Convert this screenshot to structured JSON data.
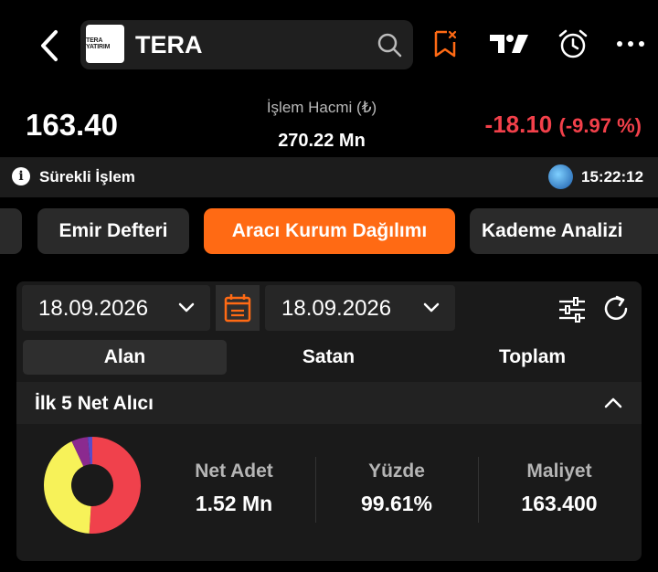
{
  "header": {
    "logo_text": "TERA YATIRIM",
    "ticker": "TERA"
  },
  "quote": {
    "price": "163.40",
    "volume_label": "İşlem Hacmi (₺)",
    "volume_value": "270.22 Mn",
    "change": "-18.10",
    "change_pct": "(-9.97 %)"
  },
  "status": {
    "session": "Sürekli İşlem",
    "time": "15:22:12"
  },
  "tabs": [
    {
      "label": "Emir Defteri",
      "active": false
    },
    {
      "label": "Aracı Kurum Dağılımı",
      "active": true
    },
    {
      "label": "Kademe Analizi",
      "active": false
    }
  ],
  "filters": {
    "start_date": "18.09.2026",
    "end_date": "18.09.2026"
  },
  "segments": [
    {
      "label": "Alan",
      "active": true
    },
    {
      "label": "Satan",
      "active": false
    },
    {
      "label": "Toplam",
      "active": false
    }
  ],
  "section": {
    "title": "İlk 5 Net Alıcı"
  },
  "stats": {
    "net_adet_label": "Net Adet",
    "net_adet_value": "1.52 Mn",
    "yuzde_label": "Yüzde",
    "yuzde_value": "99.61%",
    "maliyet_label": "Maliyet",
    "maliyet_value": "163.400"
  },
  "donut": {
    "slices": [
      {
        "value": 51,
        "color": "#f0414c"
      },
      {
        "value": 42,
        "color": "#f7f259"
      },
      {
        "value": 5.5,
        "color": "#8b2a8f"
      },
      {
        "value": 1.5,
        "color": "#5a4bc9"
      }
    ]
  },
  "colors": {
    "accent": "#ff6a14",
    "negative": "#f2404a"
  }
}
